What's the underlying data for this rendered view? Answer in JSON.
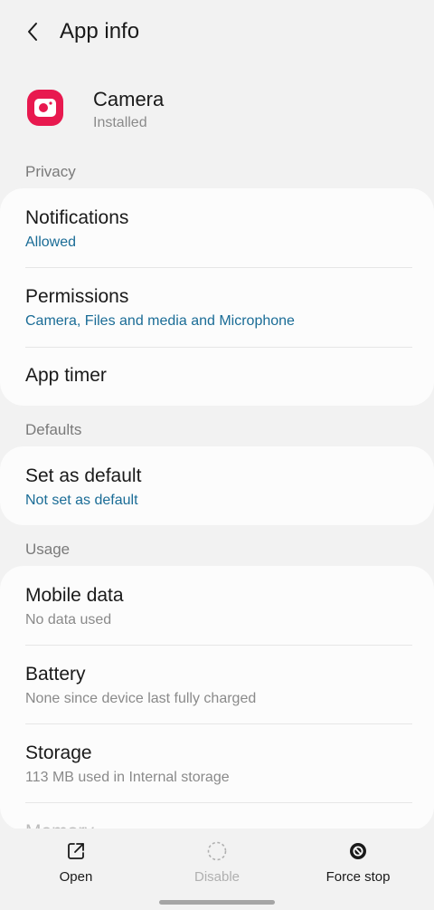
{
  "header": {
    "title": "App info"
  },
  "app": {
    "name": "Camera",
    "status": "Installed",
    "icon": "camera-app-icon",
    "accent": "#e8194f"
  },
  "sections": {
    "privacy": {
      "label": "Privacy",
      "items": [
        {
          "title": "Notifications",
          "subtitle": "Allowed"
        },
        {
          "title": "Permissions",
          "subtitle": "Camera, Files and media and Microphone"
        },
        {
          "title": "App timer"
        }
      ]
    },
    "defaults": {
      "label": "Defaults",
      "items": [
        {
          "title": "Set as default",
          "subtitle": "Not set as default"
        }
      ]
    },
    "usage": {
      "label": "Usage",
      "items": [
        {
          "title": "Mobile data",
          "subtitle": "No data used"
        },
        {
          "title": "Battery",
          "subtitle": "None since device last fully charged"
        },
        {
          "title": "Storage",
          "subtitle": "113 MB used in Internal storage"
        },
        {
          "title": "Memory"
        }
      ]
    }
  },
  "bottom_bar": {
    "open_label": "Open",
    "disable_label": "Disable",
    "force_stop_label": "Force stop"
  },
  "colors": {
    "link_blue": "#1a6c96",
    "background": "#f2f2f2",
    "card": "#fcfcfc"
  }
}
